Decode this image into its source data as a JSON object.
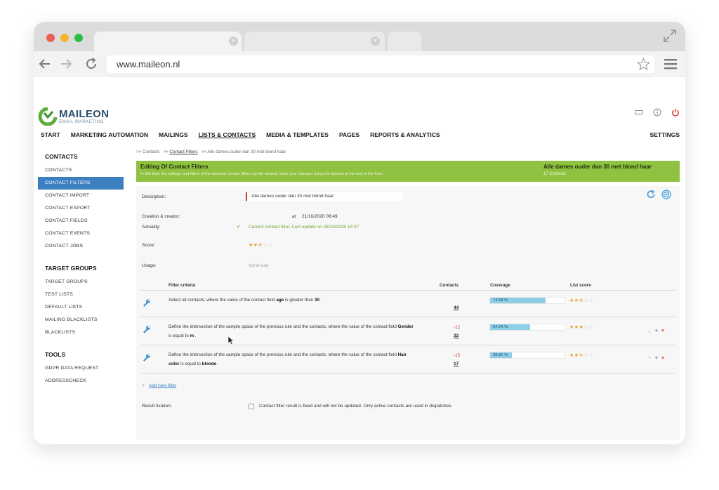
{
  "browser": {
    "url": "www.maileon.nl",
    "traffic_colors": [
      "#ec5f57",
      "#f4b42e",
      "#2fbd46"
    ]
  },
  "app": {
    "logo_name": "MAILEON",
    "logo_sub": "EMAIL MARKETING",
    "nav": [
      "START",
      "MARKETING AUTOMATION",
      "MAILINGS",
      "LISTS & CONTACTS",
      "MEDIA & TEMPLATES",
      "PAGES",
      "REPORTS & ANALYTICS"
    ],
    "nav_settings": "SETTINGS",
    "accent": "#3b7fc0",
    "banner_color": "#8fc240"
  },
  "sidebar": {
    "contacts_head": "CONTACTS",
    "contacts_items": [
      "CONTACTS",
      "CONTACT FILTERS",
      "CONTACT IMPORT",
      "CONTACT EXPORT",
      "CONTACT FIELDS",
      "CONTACT EVENTS",
      "CONTACT JOBS"
    ],
    "target_head": "TARGET GROUPS",
    "target_items": [
      "TARGET GROUPS",
      "TEST LISTS",
      "DEFAULT LISTS",
      "MAILING BLACKLISTS",
      "BLACKLISTS"
    ],
    "tools_head": "TOOLS",
    "tools_items": [
      "GDPR DATA REQUEST",
      "ADDRESSCHECK"
    ]
  },
  "breadcrumb": {
    "sep": ">>",
    "c1": "Contacts",
    "c2": "Contact Filters",
    "c3": "Alle dames ouder dan 30 met blond haar"
  },
  "banner": {
    "title": "Editing Of Contact Filters",
    "desc": "In this field, the settings and filters of the selected contact filters can be revised. Save your changes using the buttons at the end of the form.",
    "right_title": "Alle dames ouder dan 30 met blond haar",
    "right_sub": "17 Contacts"
  },
  "form": {
    "description_label": "Description:",
    "description_value": "Alle dames ouder dan 30 met blond haar",
    "creation_label": "Creation & creator:",
    "creation_at": "at",
    "creation_value": "21/10/2020 09:49",
    "actuality_label": "Actuality:",
    "actuality_value": "Current contact filter. Last update on 28/10/2020 15:07",
    "score_label": "Score:",
    "score_stars": 2.5,
    "usage_label": "Usage:",
    "usage_value": "not in use"
  },
  "table": {
    "headers": {
      "criteria": "Filter criteria",
      "contacts": "Contacts",
      "coverage": "Coverage",
      "score": "List score"
    },
    "rows": [
      {
        "text_pre": "Select all contacts, where the value of the contact field ",
        "field": "age",
        "text_mid": " is greater than ",
        "value": "30",
        "text_post": " .",
        "diff": "",
        "count": "44",
        "coverage_label": "74.58 %",
        "coverage": 74.58,
        "stars": 2.5,
        "actions": ""
      },
      {
        "text_pre": "Define the intersection of the sample space of the previous rule and the contacts, where the value of the contact field ",
        "field": "Gender",
        "text_mid": " is equal to ",
        "value": "m",
        "text_post": " .",
        "diff": "-12",
        "count": "32",
        "coverage_label": "54.24 %",
        "coverage": 54.24,
        "stars": 3,
        "actions": "down"
      },
      {
        "text_pre": "Define the intersection of the sample space of the previous rule and the contacts, where the value of the contact field ",
        "field": "Hair color",
        "text_mid": " is equal to ",
        "value": "blonde",
        "text_post": " .",
        "diff": "-15",
        "count": "17",
        "coverage_label": "28.81 %",
        "coverage": 28.81,
        "stars": 2.5,
        "actions": "up"
      }
    ],
    "add_filter": "Add new filter",
    "add_filter_icon": "+"
  },
  "fixation": {
    "label": "Result fixation:",
    "text": "Contact filter result is fixed and will not be updated. Only active contacts are used in dispatches."
  }
}
